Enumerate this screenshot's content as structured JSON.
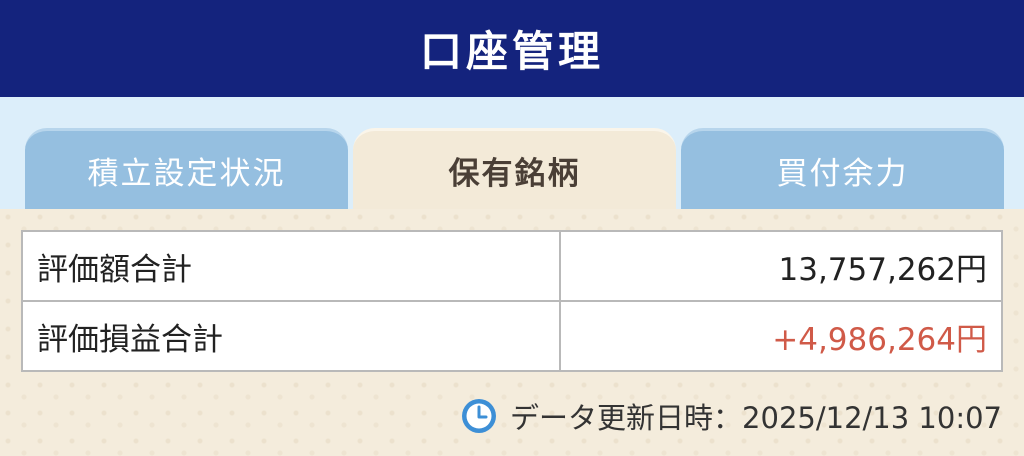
{
  "header": {
    "title": "口座管理"
  },
  "tabs": [
    {
      "label": "積立設定状況",
      "active": false
    },
    {
      "label": "保有銘柄",
      "active": true
    },
    {
      "label": "買付余力",
      "active": false
    }
  ],
  "summary": {
    "rows": [
      {
        "label": "評価額合計",
        "value": "13,757,262円"
      },
      {
        "label": "評価損益合計",
        "value": "+4,986,264円"
      }
    ]
  },
  "update": {
    "icon": "clock-icon",
    "label": "データ更新日時：2025/12/13 10:07"
  },
  "colors": {
    "header_bg": "#14237d",
    "tab_inactive": "#95bfe0",
    "tab_active": "#f3ead8",
    "positive_value": "#d05a48",
    "clock_icon": "#3d8fd6"
  }
}
